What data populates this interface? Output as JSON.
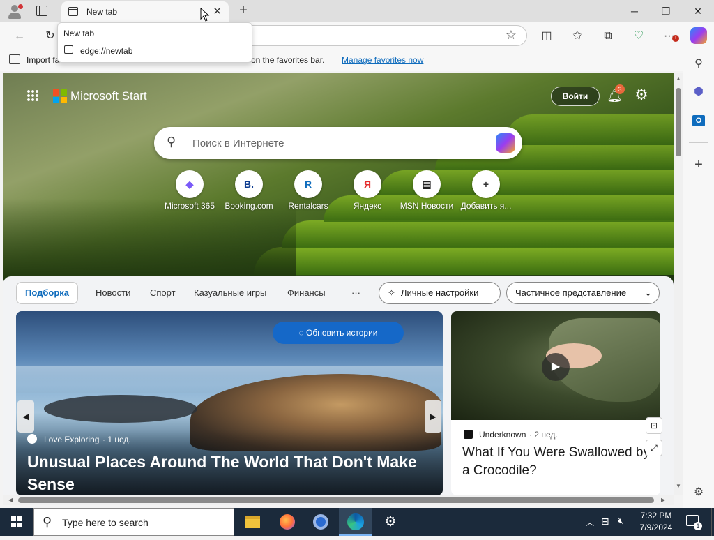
{
  "window": {
    "tab_title": "New tab",
    "tab_popup_title": "New tab",
    "tab_popup_url": "edge://newtab"
  },
  "favbar": {
    "import_label": "Import fa",
    "hint_text": "re on the favorites bar.",
    "manage_link": "Manage favorites now"
  },
  "msstart": {
    "brand": "Microsoft Start",
    "signin": "Войти",
    "notif_count": "3",
    "search_placeholder": "Поиск в Интернете",
    "quicklinks": [
      {
        "label": "Microsoft 365",
        "glyph": "◆"
      },
      {
        "label": "Booking.com",
        "glyph": "B."
      },
      {
        "label": "Rentalcars",
        "glyph": "R"
      },
      {
        "label": "Яндекс",
        "glyph": "Я"
      },
      {
        "label": "MSN Новости",
        "glyph": "▤"
      },
      {
        "label": "Добавить я...",
        "glyph": "+"
      }
    ]
  },
  "feed": {
    "tabs": [
      "Подборка",
      "Новости",
      "Спорт",
      "Казуальные игры",
      "Финансы",
      "···"
    ],
    "personalize": "Личные настройки",
    "view_mode": "Частичное представление",
    "refresh": "Обновить истории",
    "card1": {
      "source": "Love Exploring",
      "age": "· 1 нед.",
      "headline": "Unusual Places Around The World That Don't Make Sense"
    },
    "card2": {
      "source": "Underknown",
      "age": "· 2 нед.",
      "headline": "What If You Were Swallowed by a Crocodile?"
    }
  },
  "taskbar": {
    "search_placeholder": "Type here to search",
    "time": "7:32 PM",
    "date": "7/9/2024",
    "notification_count": "1"
  },
  "colors": {
    "accent": "#0f6cbd",
    "refresh_bg": "#1568c8",
    "taskbar": "#1b2a3b"
  }
}
